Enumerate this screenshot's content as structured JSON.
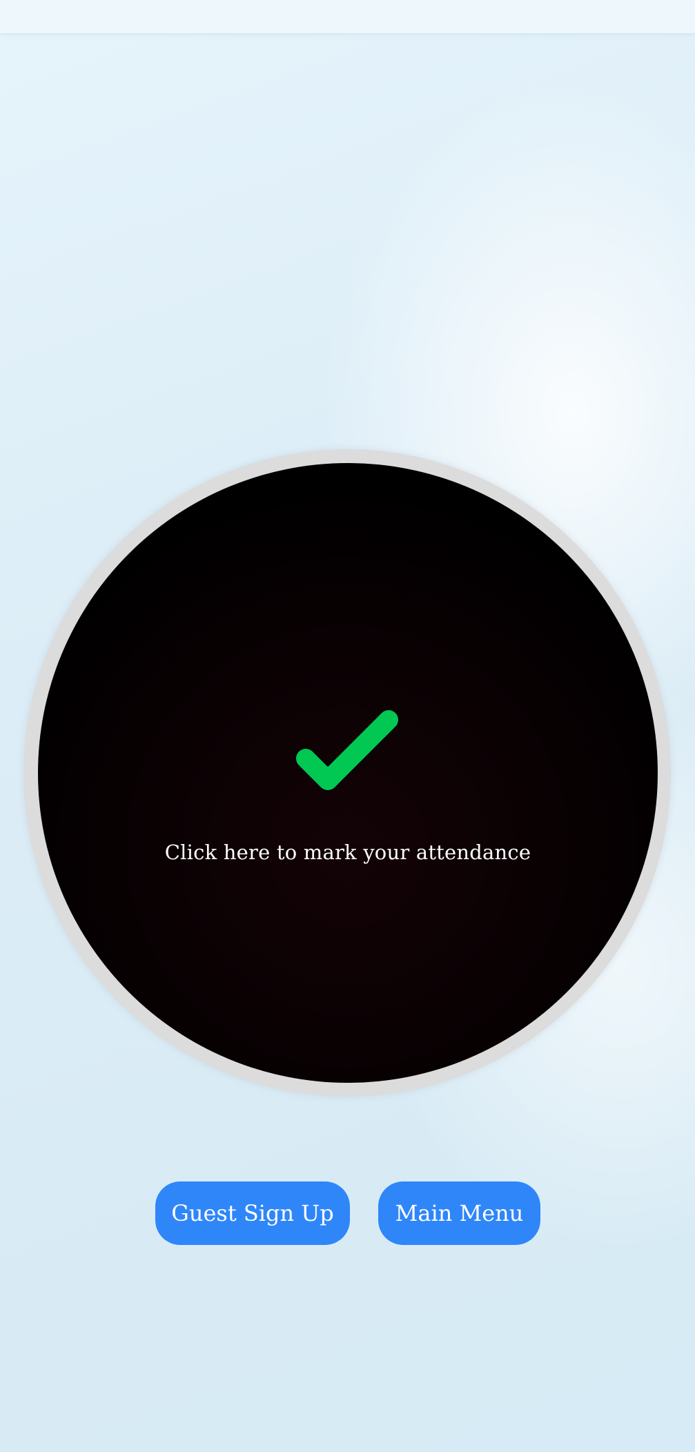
{
  "attendance": {
    "label": "Click here to mark your attendance",
    "icon": "checkmark-icon",
    "icon_color": "#00c853"
  },
  "buttons": {
    "guest_signup_label": "Guest Sign Up",
    "main_menu_label": "Main Menu",
    "color": "#2f86f8"
  }
}
